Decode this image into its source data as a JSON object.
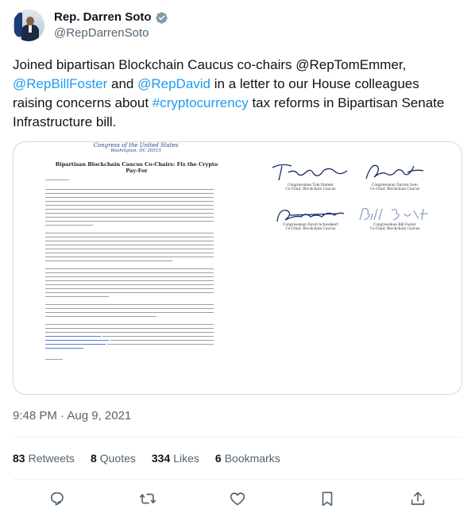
{
  "author": {
    "display_name": "Rep. Darren Soto",
    "handle": "@RepDarrenSoto",
    "verified_color": "#829aab"
  },
  "tweet": {
    "t1": "Joined bipartisan Blockchain Caucus co-chairs @RepTomEmmer,",
    "l1": "@RepBillFoster",
    "t2": " and ",
    "l2": "@RepDavid",
    "t3": " in a letter to our House colleagues raising concerns about ",
    "l3": "#cryptocurrency",
    "t4": " tax reforms in Bipartisan Senate Infrastructure bill."
  },
  "media": {
    "letterhead": "Congress of the United States",
    "letterhead_sub": "Washington, DC 20515",
    "letter_title": "Bipartisan Blockchain Caucus Co-Chairs: Fix the Crypto Pay-For",
    "signatures": [
      {
        "name": "Congressman Tom Emmer",
        "role": "Co-Chair, Blockchain Caucus"
      },
      {
        "name": "Congressman Darren Soto",
        "role": "Co-Chair, Blockchain Caucus"
      },
      {
        "name": "Congressman David Schweikert",
        "role": "Co-Chair, Blockchain Caucus"
      },
      {
        "name": "Congressman Bill Foster",
        "role": "Co-Chair, Blockchain Caucus"
      }
    ]
  },
  "timestamp": "9:48 PM · Aug 9, 2021",
  "stats": {
    "retweets_count": "83",
    "retweets_label": "Retweets",
    "quotes_count": "8",
    "quotes_label": "Quotes",
    "likes_count": "334",
    "likes_label": "Likes",
    "bookmarks_count": "6",
    "bookmarks_label": "Bookmarks"
  },
  "actions": [
    {
      "icon": "reply-icon"
    },
    {
      "icon": "retweet-icon"
    },
    {
      "icon": "like-icon"
    },
    {
      "icon": "bookmark-icon"
    },
    {
      "icon": "share-icon"
    }
  ],
  "colors": {
    "link": "#1d9bf0",
    "secondary_text": "#536471",
    "border": "#cfd9de"
  }
}
